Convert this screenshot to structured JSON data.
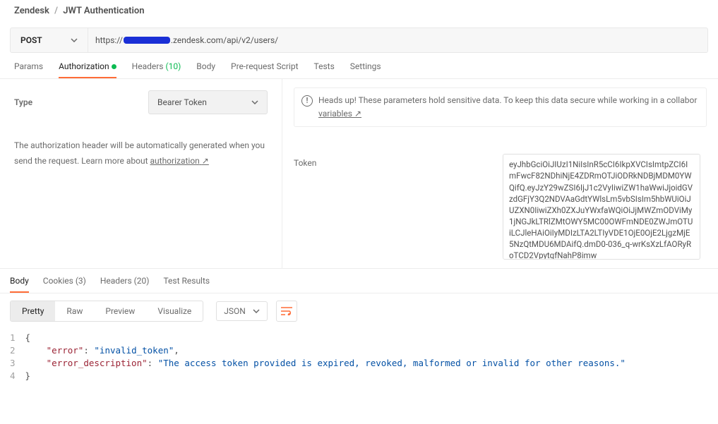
{
  "breadcrumb": {
    "parent": "Zendesk",
    "current": "JWT Authentication"
  },
  "request": {
    "method": "POST",
    "url_prefix": "https://",
    "url_suffix": ".zendesk.com/api/v2/users/"
  },
  "req_tabs": {
    "params": "Params",
    "authorization": "Authorization",
    "headers_label": "Headers",
    "headers_count": "(10)",
    "body": "Body",
    "prerequest": "Pre-request Script",
    "tests": "Tests",
    "settings": "Settings"
  },
  "auth": {
    "type_label": "Type",
    "type_value": "Bearer Token",
    "help_text_1": "The authorization header will be automatically generated when you send the request. Learn more about ",
    "help_link": "authorization",
    "arrow": "↗",
    "headsup_pre": "Heads up! These parameters hold sensitive data. To keep this data secure while working in a collabor",
    "headsup_link": "variables",
    "token_label": "Token",
    "token_value": "eyJhbGciOiJIUzI1NiIsInR5cCI6IkpXVCIsImtpZCI6ImFwcF82NDhiNjE4ZDRmOTJiODRkNDBjMDM0YWQifQ.eyJzY29wZSI6IjJ1c2VyIiwiZW1haWwiJjoidGVzdGFjY3Q2NDVAaGdtYWlsLm5vbSIsIm5hbWUiOiJUZXN0IiwiZXh0ZXJuYWxfaWQiOiJjMWZmODViMy1jNGJkLTRlZMtOWY5MC00OWFmNDE0ZWJmOTUiLCJleHAiOiIyMDIzLTA2LTIyVDE1OjE0OjE2LjgzMjE5NzQtMDU6MDAifQ.dmD0-036_q-wrKsXzLfAORyRoTCD2VpytqfNahP8imw"
  },
  "response": {
    "tabs": {
      "body": "Body",
      "cookies": "Cookies",
      "cookies_cnt": "(3)",
      "headers": "Headers",
      "headers_cnt": "(20)",
      "test": "Test Results"
    },
    "view": {
      "pretty": "Pretty",
      "raw": "Raw",
      "preview": "Preview",
      "visualize": "Visualize",
      "format": "JSON"
    },
    "body": {
      "error_key": "\"error\"",
      "error_val": "\"invalid_token\"",
      "desc_key": "\"error_description\"",
      "desc_val": "\"The access token provided is expired, revoked, malformed or invalid for other reasons.\""
    }
  }
}
